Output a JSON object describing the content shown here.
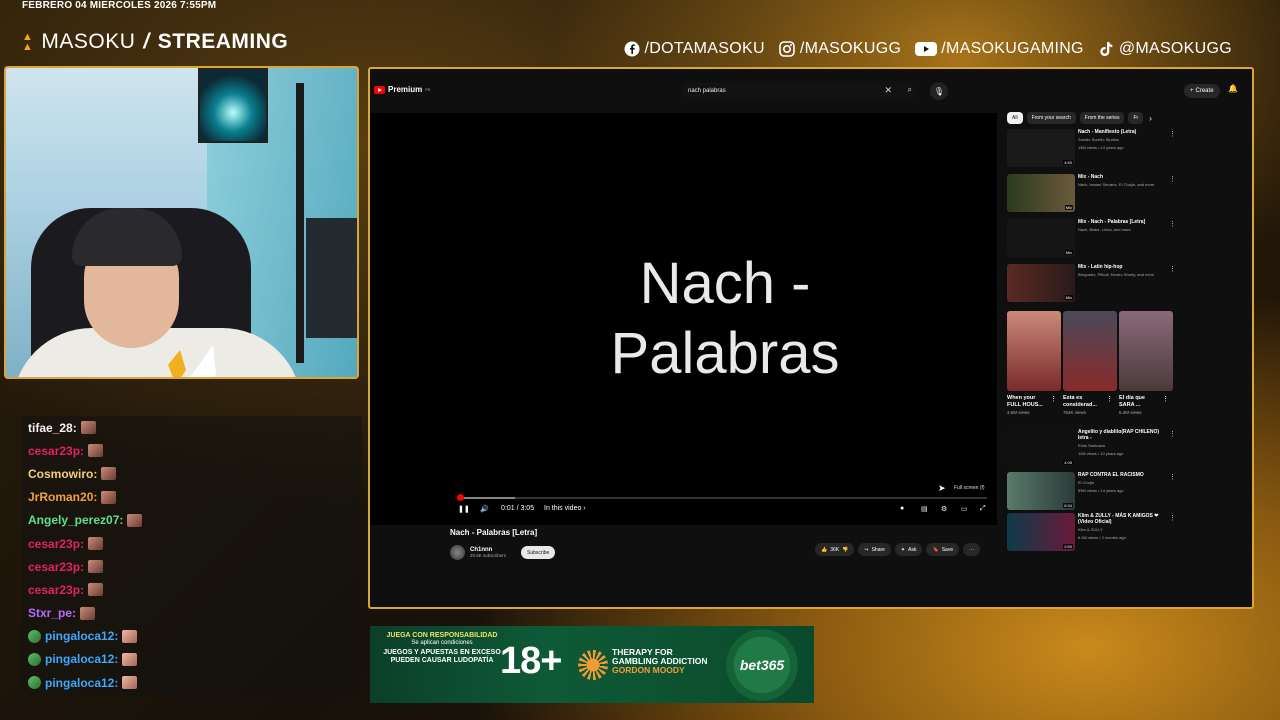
{
  "overlay": {
    "date_text": "FEBRERO 04 MIERCOLES 2026 7:55PM",
    "brand_name": "MASOKU",
    "brand_sep": "/",
    "brand_suffix": "STREAMING",
    "socials": [
      {
        "icon": "facebook-icon",
        "handle": "/DOTAMASOKU"
      },
      {
        "icon": "instagram-icon",
        "handle": "/MASOKUGG"
      },
      {
        "icon": "youtube-icon",
        "handle": "/MASOKUGAMING"
      },
      {
        "icon": "tiktok-icon",
        "handle": "@MASOKUGG"
      }
    ],
    "accent_color": "#d9a63a"
  },
  "chat": {
    "messages": [
      {
        "user": "tifae_28:",
        "color": "#f4f4f4",
        "emote": "emote"
      },
      {
        "user": "cesar23p:",
        "color": "#e0245e",
        "emote": "emote"
      },
      {
        "user": "Cosmowiro:",
        "color": "#f2d07a",
        "emote": "emote"
      },
      {
        "user": "JrRoman20:",
        "color": "#f0a040",
        "emote": "emote"
      },
      {
        "user": "Angely_perez07:",
        "color": "#5fe08a",
        "emote": "emote"
      },
      {
        "user": "cesar23p:",
        "color": "#e0245e",
        "emote": "emote"
      },
      {
        "user": "cesar23p:",
        "color": "#e0245e",
        "emote": "emote"
      },
      {
        "user": "cesar23p:",
        "color": "#e0245e",
        "emote": "emote"
      },
      {
        "user": "Stxr_pe:",
        "color": "#b36bff",
        "emote": "emote"
      },
      {
        "user": "pingaloca12:",
        "color": "#3ea8ff",
        "emote": "face"
      },
      {
        "user": "pingaloca12:",
        "color": "#3ea8ff",
        "emote": "face"
      },
      {
        "user": "pingaloca12:",
        "color": "#3ea8ff",
        "emote": "face"
      }
    ]
  },
  "youtube": {
    "logo_text": "Premium",
    "logo_sup": "PE",
    "search_value": "nach palabras",
    "create_label": "Create",
    "video_overlay_title_line1": "Nach -",
    "video_overlay_title_line2": "Palabras",
    "time": "0:01 / 3:05",
    "in_this_video": "In this video",
    "fullscreen_tip": "Full screen (f)",
    "progress_played_fraction": 0.005,
    "progress_loaded_fraction": 0.11,
    "video_title": "Nach - Palabras [Letra]",
    "channel_name": "Ch1nnn",
    "channel_subs": "20.6K subscribers",
    "subscribe_label": "Subscribe",
    "likes": "36K",
    "share_label": "Share",
    "ask_label": "Ask",
    "save_label": "Save",
    "chips": [
      "All",
      "From your search",
      "From the series",
      "Fr"
    ],
    "recommendations": [
      {
        "title": "Nach - Manifiesto (Letra)",
        "meta1": "Sonido Sureño Studios",
        "meta2": "15M views • 14 years ago",
        "duration": "4:50",
        "color": "#1a1a1a"
      },
      {
        "title": "Mix - Nach",
        "meta1": "Nach, Ismael Serrano, El Chojín, and more",
        "meta2": "",
        "duration": "Mix",
        "color": "#3a3a2a"
      },
      {
        "title": "Mix - Nach - Palabras [Letra]",
        "meta1": "Nach, Blake, Lírica, and more",
        "meta2": "",
        "duration": "Mix",
        "color": "#111"
      },
      {
        "title": "Mix - Latin hip-hop",
        "meta1": "Bregoartz, Pitbull, Neutro Shorty, and more",
        "meta2": "",
        "duration": "Mix",
        "color": "#5a2a22"
      }
    ],
    "shorts": [
      {
        "title": "When your FULL HOUS...",
        "views": "3.6M views",
        "color": "#8a3a3a"
      },
      {
        "title": "Esta es considerad...",
        "views": "764K views",
        "color": "#2a3a4a"
      },
      {
        "title": "El día que SARA ...",
        "views": "5.2M views",
        "color": "#7a5a6a"
      }
    ],
    "recommendations2": [
      {
        "title": "Angelito y diablito(RAP CHILENO) letra -",
        "meta1": "Emis Santuaza",
        "meta2": "11M views • 10 years ago",
        "duration": "4:05",
        "color": "#111"
      },
      {
        "title": "RAP CONTRA EL RACISMO",
        "meta1": "El Chojín",
        "meta2": "59M views • 14 years ago",
        "duration": "6:34",
        "color": "#3a5a4a"
      },
      {
        "title": "Klim & ZULLY - MÁS K AMIGOS ❤ (Video Oficial)",
        "meta1": "Klim & ZULLY",
        "meta2": "6.2M views • 2 months ago",
        "duration": "2:50",
        "color": "#0e3a4a"
      }
    ]
  },
  "ad": {
    "resp_line1": "JUEGA CON RESPONSABILIDAD",
    "resp_line2": "Se aplican condiciones",
    "resp_line3": "JUEGOS Y APUESTAS EN EXCESO PUEDEN CAUSAR LUDOPATÍA",
    "age": "18+",
    "therapy_line1": "THERAPY FOR",
    "therapy_line2": "GAMBLING ADDICTION",
    "therapy_line3": "GORDON MOODY",
    "bet_brand": "bet365"
  }
}
